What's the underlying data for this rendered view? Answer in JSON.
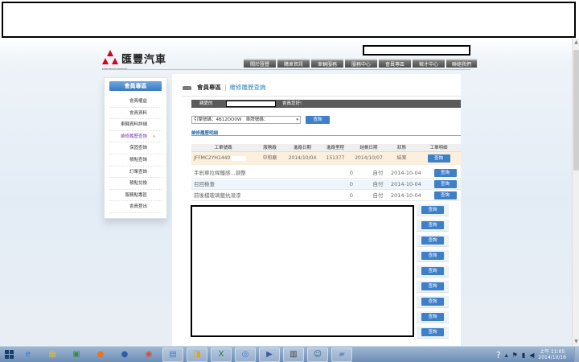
{
  "header": {
    "brand": "匯豐汽車",
    "brand_sub": "MITSUBISHI MOTORS",
    "nav": [
      "關於匯豐",
      "購車資訊",
      "車輛服務",
      "服務中心",
      "會員專區",
      "徵才中心",
      "聯絡我們"
    ]
  },
  "sidebar": {
    "title": "會員專區",
    "items": [
      {
        "label": "會員權益"
      },
      {
        "label": "會員資料"
      },
      {
        "label": "車輛資料詳細"
      },
      {
        "label": "維修履歷查詢",
        "marker": "»"
      },
      {
        "label": "保固查詢"
      },
      {
        "label": "積點查詢"
      },
      {
        "label": "訂單查詢"
      },
      {
        "label": "積點兌換"
      },
      {
        "label": "服務點專區"
      },
      {
        "label": "會員登出"
      }
    ]
  },
  "content": {
    "area": "會員專區",
    "sep": "|",
    "page": "維修履歷查詢",
    "greet_prefix": "親愛的",
    "greet_suffix": "會員您好!",
    "filter_label": "引擎號碼：4B12DO0W　車牌號碼：",
    "query_label": "查詢",
    "section_title": "維修履歷明細",
    "columns": [
      "工單號碼",
      "服務廠",
      "進廠日期",
      "進廠里程",
      "結帳日期",
      "狀態",
      "工單明細"
    ],
    "main_row": {
      "order": "JFFMC2YH1440",
      "shop": "中和廠",
      "in_date": "2014/10/04",
      "mileage": "151377",
      "out_date": "2014/10/07",
      "status": "結案",
      "button": "查詢"
    },
    "details": [
      {
        "name": "手剎車拉桿鐵感...調整",
        "qty": "0",
        "pay": "自付",
        "date": "2014-10-04",
        "button": "查詢"
      },
      {
        "name": "召回檢查",
        "qty": "0",
        "pay": "自付",
        "date": "2014-10-04",
        "button": "查詢"
      },
      {
        "name": "前後檔玻璃鍍抗潑漆",
        "qty": "0",
        "pay": "自付",
        "date": "2014-10-04",
        "button": "查詢"
      }
    ],
    "extra_buttons": [
      "查詢",
      "查詢",
      "查詢",
      "查詢",
      "查詢",
      "查詢",
      "查詢",
      "查詢",
      "查詢"
    ]
  },
  "taskbar": {
    "apps": [
      {
        "icon": "internet-explorer-icon",
        "glyph": "e",
        "color": "#1e7fd8"
      },
      {
        "icon": "file-explorer-icon",
        "glyph": "▦",
        "color": "#e0b347"
      },
      {
        "icon": "excel-icon",
        "glyph": "▣",
        "color": "#2f8f3f"
      },
      {
        "icon": "firefox-icon",
        "glyph": "●",
        "color": "#e8731e"
      },
      {
        "icon": "globe-icon",
        "glyph": "●",
        "color": "#2a5ea8"
      },
      {
        "icon": "chrome-icon",
        "glyph": "◉",
        "color": "#d94a38"
      },
      {
        "icon": "remote-desktop-icon",
        "glyph": "▤",
        "color": "#3f7fc7"
      },
      {
        "icon": "outlook-icon",
        "glyph": "◨",
        "color": "#e6a21a"
      },
      {
        "icon": "excel-window-icon",
        "glyph": "X",
        "color": "#1f7a3b"
      },
      {
        "icon": "network-tool-icon",
        "glyph": "◎",
        "color": "#3a7bd5"
      },
      {
        "icon": "media-icon",
        "glyph": "▶",
        "color": "#3d5aa8"
      },
      {
        "icon": "film-icon",
        "glyph": "▥",
        "color": "#444444"
      },
      {
        "icon": "user-icon",
        "glyph": "☺",
        "color": "#2f5f8f"
      },
      {
        "icon": "chat-icon",
        "glyph": "▰",
        "color": "#6b8fc4"
      }
    ],
    "time": "上午 11:05",
    "date": "2014/10/16"
  }
}
